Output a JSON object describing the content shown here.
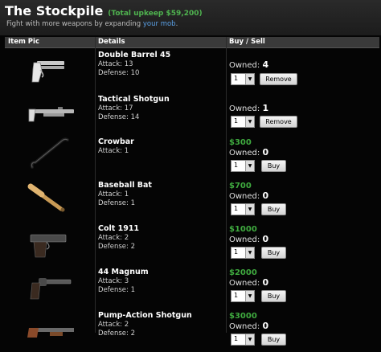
{
  "header": {
    "title": "The Stockpile",
    "upkeep": "(Total upkeep $59,200)",
    "subtitle_prefix": "Fight with more weapons by expanding ",
    "subtitle_link": "your mob",
    "subtitle_suffix": "."
  },
  "table": {
    "col_pic": "Item Pic",
    "col_details": "Details",
    "col_buysell": "Buy / Sell"
  },
  "items": [
    {
      "name": "Double Barrel 45",
      "attack": "Attack: 13",
      "defense": "Defense: 10",
      "price": "",
      "owned_label": "Owned: ",
      "owned": "4",
      "qty": "1",
      "action": "Remove",
      "icon": "derringer-pistol-icon"
    },
    {
      "name": "Tactical Shotgun",
      "attack": "Attack: 17",
      "defense": "Defense: 14",
      "price": "",
      "owned_label": "Owned: ",
      "owned": "1",
      "qty": "1",
      "action": "Remove",
      "icon": "tactical-shotgun-icon"
    },
    {
      "name": "Crowbar",
      "attack": "Attack: 1",
      "defense": "",
      "price": "$300",
      "owned_label": "Owned: ",
      "owned": "0",
      "qty": "1",
      "action": "Buy",
      "icon": "crowbar-icon"
    },
    {
      "name": "Baseball Bat",
      "attack": "Attack: 1",
      "defense": "Defense: 1",
      "price": "$700",
      "owned_label": "Owned: ",
      "owned": "0",
      "qty": "1",
      "action": "Buy",
      "icon": "baseball-bat-icon"
    },
    {
      "name": "Colt 1911",
      "attack": "Attack: 2",
      "defense": "Defense: 2",
      "price": "$1000",
      "owned_label": "Owned: ",
      "owned": "0",
      "qty": "1",
      "action": "Buy",
      "icon": "pistol-icon"
    },
    {
      "name": "44 Magnum",
      "attack": "Attack: 3",
      "defense": "Defense: 1",
      "price": "$2000",
      "owned_label": "Owned: ",
      "owned": "0",
      "qty": "1",
      "action": "Buy",
      "icon": "revolver-icon"
    },
    {
      "name": "Pump-Action Shotgun",
      "attack": "Attack: 2",
      "defense": "Defense: 2",
      "price": "$3000",
      "owned_label": "Owned: ",
      "owned": "0",
      "qty": "1",
      "action": "Buy",
      "icon": "pump-shotgun-icon"
    }
  ],
  "colors": {
    "price": "#3faa3f",
    "upkeep": "#4fb34f",
    "link": "#5aa0e6"
  }
}
